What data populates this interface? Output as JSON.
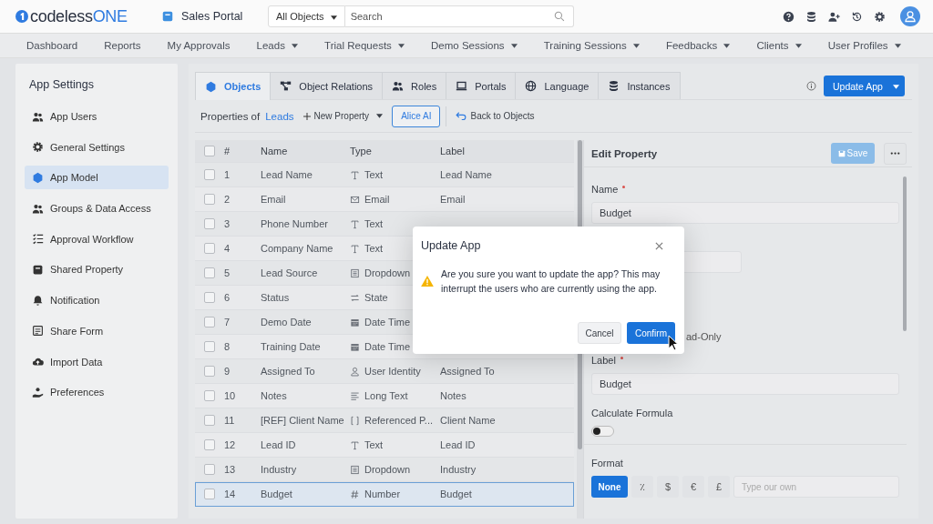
{
  "header": {
    "logo": {
      "main": "codeless",
      "accent": "ONE"
    },
    "app_name": "Sales Portal",
    "search": {
      "scope": "All Objects",
      "placeholder": "Search"
    }
  },
  "nav": [
    {
      "label": "Dashboard",
      "dropdown": false
    },
    {
      "label": "Reports",
      "dropdown": false
    },
    {
      "label": "My Approvals",
      "dropdown": false
    },
    {
      "label": "Leads",
      "dropdown": true
    },
    {
      "label": "Trial Requests",
      "dropdown": true
    },
    {
      "label": "Demo Sessions",
      "dropdown": true
    },
    {
      "label": "Training Sessions",
      "dropdown": true
    },
    {
      "label": "Feedbacks",
      "dropdown": true
    },
    {
      "label": "Clients",
      "dropdown": true
    },
    {
      "label": "User Profiles",
      "dropdown": true
    }
  ],
  "sidebar": {
    "title": "App Settings",
    "items": [
      {
        "label": "App Users",
        "selected": false
      },
      {
        "label": "General Settings",
        "selected": false
      },
      {
        "label": "App Model",
        "selected": true
      },
      {
        "label": "Groups & Data Access",
        "selected": false
      },
      {
        "label": "Approval Workflow",
        "selected": false
      },
      {
        "label": "Shared Property",
        "selected": false
      },
      {
        "label": "Notification",
        "selected": false
      },
      {
        "label": "Share Form",
        "selected": false
      },
      {
        "label": "Import Data",
        "selected": false
      },
      {
        "label": "Preferences",
        "selected": false
      }
    ]
  },
  "tabs": [
    {
      "label": "Objects",
      "selected": true
    },
    {
      "label": "Object Relations",
      "selected": false
    },
    {
      "label": "Roles",
      "selected": false
    },
    {
      "label": "Portals",
      "selected": false
    },
    {
      "label": "Language",
      "selected": false
    },
    {
      "label": "Instances",
      "selected": false
    }
  ],
  "update_button": {
    "label": "Update App"
  },
  "toolbar": {
    "prefix": "Properties of",
    "object": "Leads",
    "new_property": "New Property",
    "alice": "Alice AI",
    "back": "Back to Objects"
  },
  "table": {
    "select_all": {
      "checked": false
    },
    "columns": [
      "#",
      "Name",
      "Type",
      "Label"
    ],
    "rows": [
      {
        "number": "1",
        "name": "Lead Name",
        "type": "Text",
        "kind": "text",
        "label": "Lead Name",
        "checked": false,
        "selected": false
      },
      {
        "number": "2",
        "name": "Email",
        "type": "Email",
        "kind": "email",
        "label": "Email",
        "checked": false,
        "selected": false
      },
      {
        "number": "3",
        "name": "Phone Number",
        "type": "Text",
        "kind": "text",
        "checked": false,
        "selected": false
      },
      {
        "number": "4",
        "name": "Company Name",
        "type": "Text",
        "kind": "text",
        "checked": false,
        "selected": false
      },
      {
        "number": "5",
        "name": "Lead Source",
        "type": "Dropdown",
        "kind": "dropdown",
        "checked": false,
        "selected": false
      },
      {
        "number": "6",
        "name": "Status",
        "type": "State",
        "kind": "state",
        "checked": false,
        "selected": false
      },
      {
        "number": "7",
        "name": "Demo Date",
        "type": "Date Time",
        "kind": "datetime",
        "checked": false,
        "selected": false
      },
      {
        "number": "8",
        "name": "Training Date",
        "type": "Date Time",
        "kind": "datetime",
        "checked": false,
        "selected": false
      },
      {
        "number": "9",
        "name": "Assigned To",
        "type": "User Identity",
        "kind": "user",
        "label": "Assigned To",
        "checked": false,
        "selected": false
      },
      {
        "number": "10",
        "name": "Notes",
        "type": "Long Text",
        "kind": "longtext",
        "label": "Notes",
        "checked": false,
        "selected": false
      },
      {
        "number": "11",
        "name": "[REF] Client Name",
        "type": "Referenced P...",
        "kind": "reference",
        "label": "Client Name",
        "checked": false,
        "selected": false
      },
      {
        "number": "12",
        "name": "Lead ID",
        "type": "Text",
        "kind": "text",
        "label": "Lead ID",
        "checked": false,
        "selected": false
      },
      {
        "number": "13",
        "name": "Industry",
        "type": "Dropdown",
        "kind": "dropdown",
        "label": "Industry",
        "checked": false,
        "selected": false
      },
      {
        "number": "14",
        "name": "Budget",
        "type": "Number",
        "kind": "number",
        "label": "Budget",
        "checked": false,
        "selected": true
      }
    ]
  },
  "edit_panel": {
    "title": "Edit Property",
    "save": "Save",
    "name_label": "Name",
    "name_value": "Budget",
    "readonly_text": "ad-Only",
    "label_label": "Label",
    "label_value": "Budget",
    "formula_label": "Calculate Formula",
    "formula_on": false,
    "format_label": "Format",
    "formats": [
      {
        "label": "None",
        "selected": true
      },
      {
        "label": "٪",
        "selected": false
      },
      {
        "label": "$",
        "selected": false
      },
      {
        "label": "€",
        "selected": false
      },
      {
        "label": "£",
        "selected": false
      }
    ],
    "format_placeholder": "Type our own"
  },
  "dialog": {
    "title": "Update App",
    "message": "Are you sure you want to update the app? This may interrupt the users who are currently using the app.",
    "cancel": "Cancel",
    "confirm": "Confirm"
  }
}
